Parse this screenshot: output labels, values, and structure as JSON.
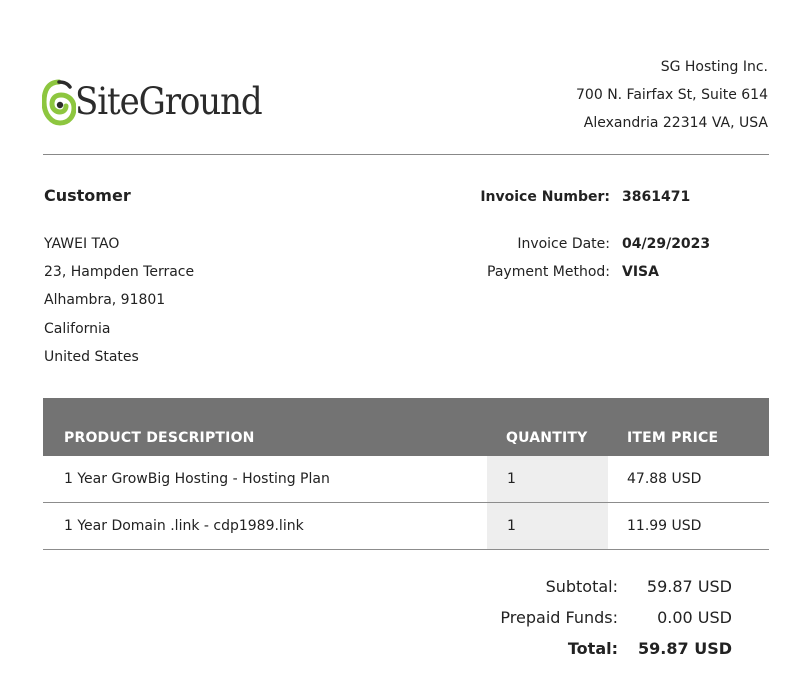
{
  "brand": {
    "logo_text": "SiteGround",
    "logo_icon": "siteground-swirl-icon",
    "accent_color": "#8dc63f"
  },
  "company": {
    "name": "SG Hosting Inc.",
    "address_line1": "700 N. Fairfax St, Suite 614",
    "address_line2": "Alexandria 22314 VA, USA"
  },
  "customer": {
    "heading": "Customer",
    "name": "YAWEI TAO",
    "street": "23, Hampden Terrace",
    "city_zip": "Alhambra, 91801",
    "state": "California",
    "country": "United States"
  },
  "invoice": {
    "number_label": "Invoice Number:",
    "number": "3861471",
    "date_label": "Invoice Date:",
    "date": "04/29/2023",
    "payment_label": "Payment Method:",
    "payment": "VISA"
  },
  "table": {
    "headers": {
      "description": "PRODUCT DESCRIPTION",
      "quantity": "QUANTITY",
      "price": "ITEM PRICE"
    },
    "rows": [
      {
        "description": "1 Year GrowBig Hosting - Hosting Plan",
        "quantity": "1",
        "price": "47.88 USD"
      },
      {
        "description": "1 Year Domain .link - cdp1989.link",
        "quantity": "1",
        "price": "11.99 USD"
      }
    ]
  },
  "totals": {
    "subtotal_label": "Subtotal:",
    "subtotal": "59.87 USD",
    "prepaid_label": "Prepaid Funds:",
    "prepaid": "0.00 USD",
    "total_label": "Total:",
    "total": "59.87 USD"
  }
}
